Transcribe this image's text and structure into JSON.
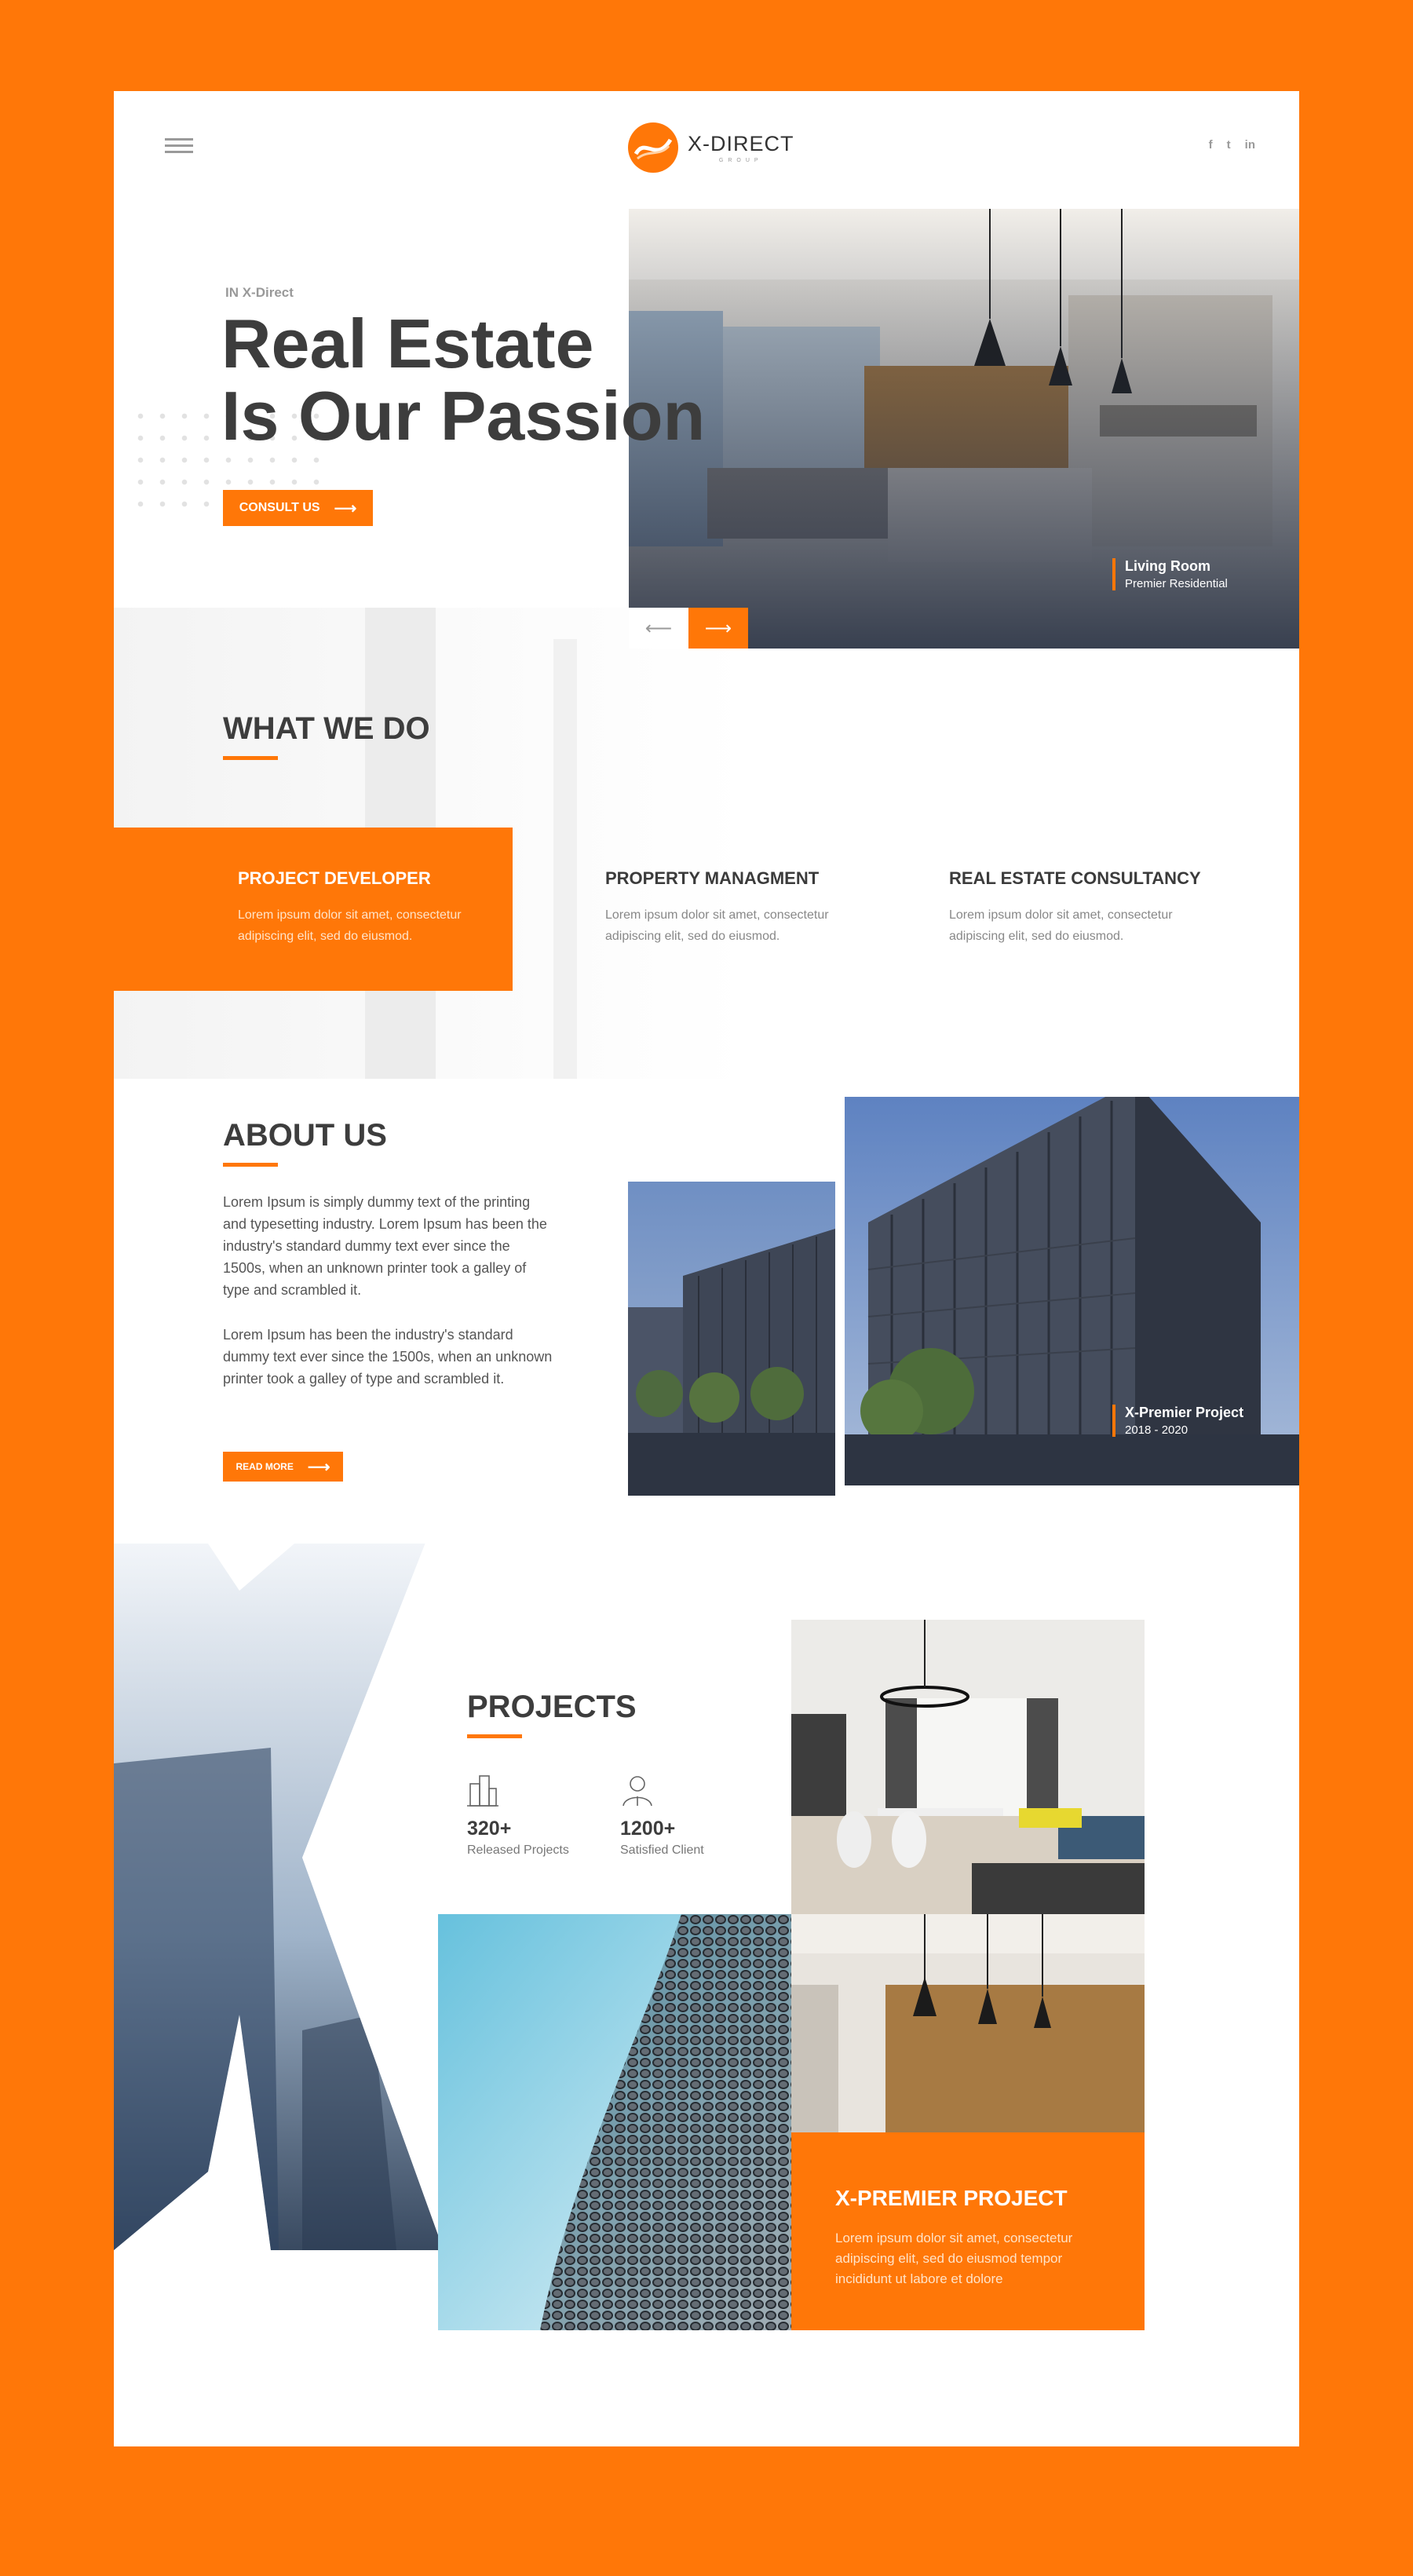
{
  "brand": {
    "name": "X-DIRECT",
    "sub": "GROUP"
  },
  "social": [
    "f",
    "t",
    "in"
  ],
  "hero": {
    "kicker": "IN X-Direct",
    "title_line1": "Real Estate",
    "title_line2": "Is Our Passion",
    "cta": "CONSULT US",
    "caption_title": "Living Room",
    "caption_sub": "Premier Residential"
  },
  "what_we_do": {
    "title": "WHAT WE DO",
    "services": [
      {
        "title": "PROJECT DEVELOPER",
        "text": "Lorem ipsum dolor sit amet, consectetur adipiscing elit, sed do eiusmod."
      },
      {
        "title": "PROPERTY MANAGMENT",
        "text": "Lorem ipsum dolor sit amet, consectetur adipiscing elit, sed do eiusmod."
      },
      {
        "title": "REAL ESTATE CONSULTANCY",
        "text": "Lorem ipsum dolor sit amet, consectetur adipiscing elit, sed do eiusmod."
      }
    ]
  },
  "about": {
    "title": "ABOUT US",
    "p1": "Lorem Ipsum is simply dummy text of the printing and typesetting industry. Lorem Ipsum has been the industry's standard dummy text ever since the 1500s, when an unknown printer took a galley of type and scrambled it.",
    "p2": "Lorem Ipsum has been the industry's standard dummy text ever since the 1500s, when an unknown printer took a galley of type and scrambled it.",
    "cta": "READ MORE",
    "caption_title": "X-Premier Project",
    "caption_sub": "2018 - 2020"
  },
  "projects": {
    "title": "PROJECTS",
    "stats": [
      {
        "num": "320+",
        "label": "Released Projects"
      },
      {
        "num": "1200+",
        "label": "Satisfied Client"
      }
    ],
    "featured_title": "X-PREMIER PROJECT",
    "featured_text": "Lorem ipsum dolor sit amet, consectetur adipiscing elit, sed do eiusmod tempor incididunt ut labore et dolore"
  },
  "colors": {
    "accent": "#ff7708",
    "text": "#3d3d3d"
  }
}
